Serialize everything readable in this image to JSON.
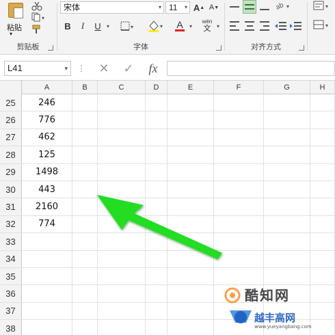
{
  "ribbon": {
    "clipboard": {
      "paste_label": "粘贴",
      "group_label": "剪贴板"
    },
    "font": {
      "font_name": "宋体",
      "font_size": "11",
      "group_label": "字体",
      "bold": "B",
      "italic": "I",
      "underline": "U",
      "font_color_glyph": "A",
      "phonetic_top": "wén",
      "phonetic_bottom": "文",
      "grow_glyph": "A",
      "shrink_glyph": "A"
    },
    "alignment": {
      "group_label": "对齐方式"
    }
  },
  "formula_bar": {
    "name_box": "L41",
    "cancel_glyph": "✕",
    "enter_glyph": "✓",
    "fx_glyph": "fx",
    "formula_value": ""
  },
  "sheet": {
    "columns": [
      "A",
      "B",
      "C",
      "D",
      "E",
      "F",
      "G",
      "H"
    ],
    "rows": [
      {
        "num": "25",
        "a": "246"
      },
      {
        "num": "26",
        "a": "776"
      },
      {
        "num": "27",
        "a": "462"
      },
      {
        "num": "28",
        "a": "125"
      },
      {
        "num": "29",
        "a": "1498"
      },
      {
        "num": "30",
        "a": "443"
      },
      {
        "num": "31",
        "a": "2160"
      },
      {
        "num": "32",
        "a": "774"
      },
      {
        "num": "33",
        "a": ""
      },
      {
        "num": "34",
        "a": ""
      },
      {
        "num": "35",
        "a": ""
      },
      {
        "num": "36",
        "a": ""
      },
      {
        "num": "37",
        "a": ""
      },
      {
        "num": "38",
        "a": ""
      }
    ]
  },
  "watermark": {
    "text_1": "酷知网",
    "text_2": "越丰高网",
    "url": "www.yueyangbang.com"
  },
  "colors": {
    "arrow": "#22dd22",
    "accent": "#217346"
  }
}
